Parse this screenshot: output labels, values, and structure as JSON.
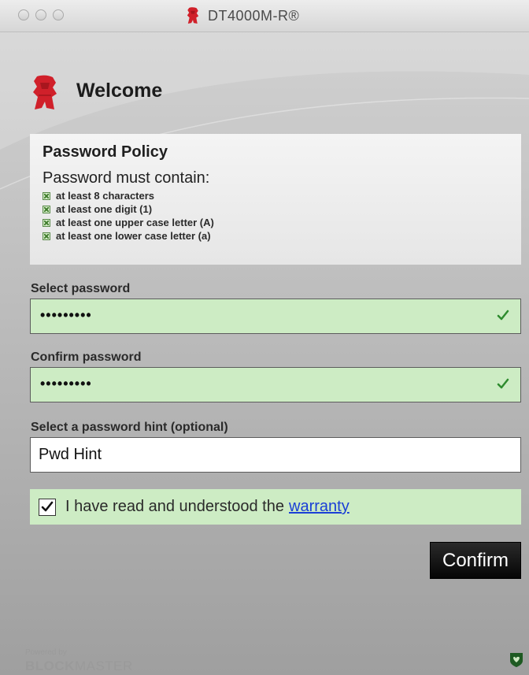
{
  "window": {
    "title": "DT4000M-R®"
  },
  "welcome": {
    "title": "Welcome"
  },
  "policy": {
    "title": "Password Policy",
    "subtitle": "Password must contain:",
    "items": [
      "at least 8 characters",
      "at least one digit (1)",
      "at least one upper case letter (A)",
      "at least one lower case letter (a)"
    ]
  },
  "form": {
    "select_label": "Select password",
    "select_value": "•••••••••",
    "confirm_label": "Confirm password",
    "confirm_value": "•••••••••",
    "hint_label": "Select a password hint (optional)",
    "hint_value": "Pwd Hint"
  },
  "warranty": {
    "text": "I have read and understood the",
    "link": "warranty",
    "checked": true
  },
  "actions": {
    "confirm_label": "Confirm"
  },
  "footer": {
    "powered_by": "Powered by",
    "brand_bold": "BLOCK",
    "brand_rest": "MASTER"
  },
  "colors": {
    "valid_field_bg": "#cdecc4",
    "valid_check": "#2e8b2e",
    "logo_red": "#d0202a",
    "link": "#1a3fd6"
  },
  "icons": {
    "title_logo": "kingston-logo-icon",
    "welcome_logo": "kingston-logo-icon",
    "field_valid": "checkmark-icon",
    "footer": "shield-icon"
  }
}
